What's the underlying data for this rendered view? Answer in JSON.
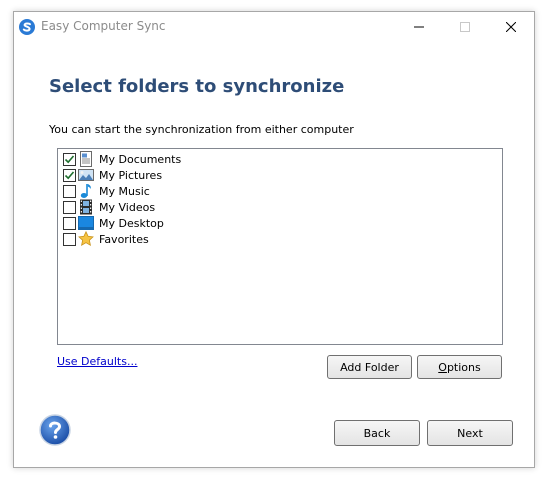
{
  "window": {
    "title": "Easy Computer Sync",
    "heading": "Select folders to synchronize",
    "subtext": "You can start the synchronization from either computer"
  },
  "colors": {
    "heading": "#2e4d77",
    "link": "#0000cc",
    "checkmark": "#1e6f2e"
  },
  "folders": [
    {
      "label": "My Documents",
      "checked": true,
      "icon": "documents-icon"
    },
    {
      "label": "My Pictures",
      "checked": true,
      "icon": "pictures-icon"
    },
    {
      "label": "My Music",
      "checked": false,
      "icon": "music-note-icon"
    },
    {
      "label": "My Videos",
      "checked": false,
      "icon": "film-icon"
    },
    {
      "label": "My Desktop",
      "checked": false,
      "icon": "desktop-icon"
    },
    {
      "label": "Favorites",
      "checked": false,
      "icon": "star-icon"
    }
  ],
  "actions": {
    "use_defaults": "Use Defaults...",
    "add_folder": "Add Folder",
    "options": "Options",
    "back": "Back",
    "next": "Next"
  }
}
